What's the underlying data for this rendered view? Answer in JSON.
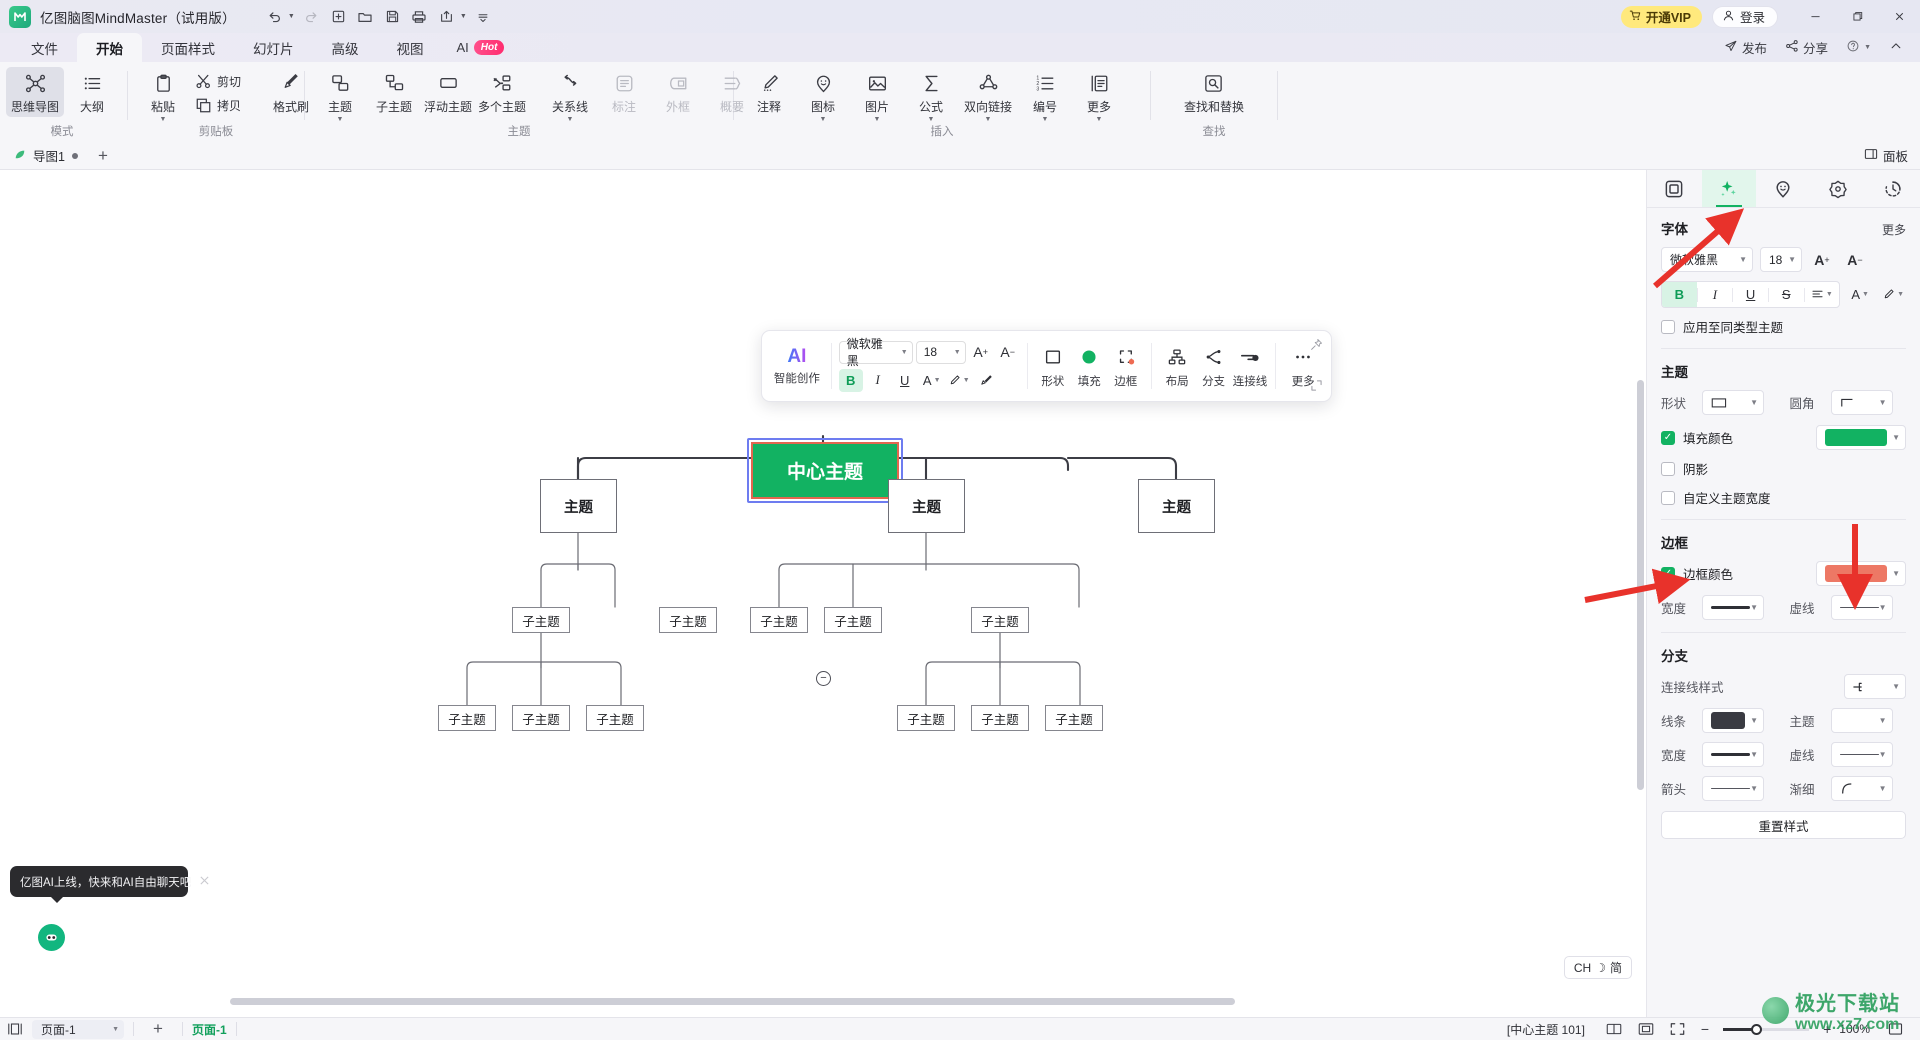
{
  "titlebar": {
    "app_name": "亿图脑图MindMaster（试用版）",
    "logo_glyph": "M",
    "quick_tools": [
      {
        "name": "undo-button",
        "glyph": "↶",
        "caret": true,
        "dim": false
      },
      {
        "name": "redo-button",
        "glyph": "↷",
        "caret": false,
        "dim": true
      },
      {
        "name": "new-button",
        "glyph": "⊞",
        "caret": false,
        "dim": false
      },
      {
        "name": "open-button",
        "glyph": "🗁",
        "caret": false,
        "dim": false
      },
      {
        "name": "save-button",
        "glyph": "🖫",
        "caret": false,
        "dim": false
      },
      {
        "name": "print-button",
        "glyph": "🖨",
        "caret": false,
        "dim": false
      },
      {
        "name": "export-button",
        "glyph": "⇪",
        "caret": true,
        "dim": false
      },
      {
        "name": "customize-toolbar-button",
        "glyph": "▾",
        "caret": false,
        "dim": false
      }
    ],
    "vip_label": "开通VIP",
    "vip_icon": "cart-icon",
    "login_label": "登录",
    "login_icon": "user-icon",
    "window_controls": [
      {
        "name": "minimize-button",
        "glyph": "—"
      },
      {
        "name": "maximize-button",
        "glyph": "❐"
      },
      {
        "name": "close-button",
        "glyph": "✕"
      }
    ]
  },
  "menubar": {
    "tabs": [
      {
        "label": "文件",
        "active": false
      },
      {
        "label": "开始",
        "active": true
      },
      {
        "label": "页面样式",
        "active": false
      },
      {
        "label": "幻灯片",
        "active": false
      },
      {
        "label": "高级",
        "active": false
      },
      {
        "label": "视图",
        "active": false
      }
    ],
    "ai_tab": {
      "label": "AI",
      "badge": "Hot"
    },
    "right_items": [
      {
        "label": "发布",
        "icon": "send-icon",
        "caret": false
      },
      {
        "label": "分享",
        "icon": "share-icon",
        "caret": false
      },
      {
        "label": "",
        "icon": "help-icon",
        "caret": true
      },
      {
        "label": "",
        "icon": "collapse-ribbon-icon",
        "caret": false
      }
    ]
  },
  "ribbon": {
    "groups": [
      {
        "title": "模式",
        "items": [
          {
            "label": "思维导图",
            "icon": "mindmap-icon",
            "selected": true,
            "dropdown": false
          },
          {
            "label": "大纲",
            "icon": "outline-icon",
            "selected": false,
            "dropdown": false
          }
        ]
      },
      {
        "title": "剪贴板",
        "items": [
          {
            "label": "粘贴",
            "icon": "paste-icon",
            "selected": false,
            "dropdown": true
          },
          {
            "label": "剪切",
            "icon": "scissors-icon",
            "selected": false,
            "dropdown": false,
            "horizontal": true
          },
          {
            "label": "拷贝",
            "icon": "copy-icon",
            "selected": false,
            "dropdown": false,
            "horizontal": true
          },
          {
            "label": "格式刷",
            "icon": "format-painter-icon",
            "selected": false,
            "dropdown": false
          }
        ]
      },
      {
        "title": "主题",
        "items": [
          {
            "label": "主题",
            "icon": "topic-icon",
            "selected": false,
            "dropdown": true
          },
          {
            "label": "子主题",
            "icon": "subtopic-icon",
            "selected": false,
            "dropdown": false
          },
          {
            "label": "浮动主题",
            "icon": "floating-topic-icon",
            "selected": false,
            "dropdown": false
          },
          {
            "label": "多个主题",
            "icon": "multi-topic-icon",
            "selected": false,
            "dropdown": false
          },
          {
            "label": "关系线",
            "icon": "relationship-line-icon",
            "selected": false,
            "dropdown": true
          },
          {
            "label": "标注",
            "icon": "callout-icon",
            "selected": false,
            "dropdown": false,
            "disabled": true
          },
          {
            "label": "外框",
            "icon": "boundary-icon",
            "selected": false,
            "dropdown": false,
            "disabled": true
          },
          {
            "label": "概要",
            "icon": "summary-icon",
            "selected": false,
            "dropdown": false,
            "disabled": true
          }
        ]
      },
      {
        "title": "插入",
        "items": [
          {
            "label": "注释",
            "icon": "comment-icon",
            "selected": false,
            "dropdown": false
          },
          {
            "label": "图标",
            "icon": "sticker-icon",
            "selected": false,
            "dropdown": true
          },
          {
            "label": "图片",
            "icon": "image-icon",
            "selected": false,
            "dropdown": true
          },
          {
            "label": "公式",
            "icon": "formula-icon",
            "selected": false,
            "dropdown": true
          },
          {
            "label": "双向链接",
            "icon": "bidirectional-link-icon",
            "selected": false,
            "dropdown": true
          },
          {
            "label": "编号",
            "icon": "numbering-icon",
            "selected": false,
            "dropdown": true
          },
          {
            "label": "更多",
            "icon": "more-insert-icon",
            "selected": false,
            "dropdown": true
          }
        ]
      },
      {
        "title": "查找",
        "items": [
          {
            "label": "查找和替换",
            "icon": "find-replace-icon",
            "selected": false,
            "dropdown": false
          }
        ]
      }
    ]
  },
  "doctabs": {
    "tabs": [
      {
        "label": "导图1",
        "modified": true
      }
    ],
    "add_label": "+",
    "panel_toggle_label": "面板",
    "panel_toggle_icon": "panel-icon"
  },
  "format_toolbar": {
    "ai_title": "AI",
    "ai_subtitle": "智能创作",
    "font_family": "微软雅黑",
    "font_size": "18",
    "increase_font_icon": "A+",
    "decrease_font_icon": "A−",
    "bold": "B",
    "italic": "I",
    "underline": "U",
    "font_color_icon": "A",
    "highlight_icon": "pen-icon",
    "clear_format_icon": "format-painter-icon",
    "big_buttons": [
      {
        "label": "形状",
        "icon": "shape-icon"
      },
      {
        "label": "填充",
        "icon": "fill-icon"
      },
      {
        "label": "边框",
        "icon": "border-icon"
      },
      {
        "label": "布局",
        "icon": "layout-icon"
      },
      {
        "label": "分支",
        "icon": "branch-icon"
      },
      {
        "label": "连接线",
        "icon": "connector-icon"
      },
      {
        "label": "更多",
        "icon": "more-icon"
      }
    ],
    "pin_icon": "pin-icon",
    "resize_icon": "resize-icon",
    "fill_color": "#12b262",
    "border_dot_color": "#ee6b52"
  },
  "mindmap": {
    "central": {
      "text": "中心主题",
      "fill": "#12b262",
      "border": "#e2674f",
      "selection": "#6d7cf0"
    },
    "level1": [
      {
        "text": "主题"
      },
      {
        "text": "主题"
      },
      {
        "text": "主题"
      }
    ],
    "level2": [
      {
        "text": "子主题"
      },
      {
        "text": "子主题"
      },
      {
        "text": "子主题"
      },
      {
        "text": "子主题"
      },
      {
        "text": "子主题"
      }
    ],
    "level3": [
      {
        "text": "子主题"
      },
      {
        "text": "子主题"
      },
      {
        "text": "子主题"
      },
      {
        "text": "子主题"
      },
      {
        "text": "子主题"
      },
      {
        "text": "子主题"
      }
    ],
    "collapse_glyph": "−"
  },
  "toast": {
    "message": "亿图AI上线，快来和AI自由聊天吧",
    "close_icon": "close-icon",
    "bot_icon": "ai-bot-icon"
  },
  "lang_pill": {
    "label": "CH",
    "extra": "简",
    "icon": "ime-icon"
  },
  "right_panel": {
    "tabs": [
      {
        "name": "tab-page",
        "icon": "page-icon",
        "active": false
      },
      {
        "name": "tab-style",
        "icon": "sparkle-icon",
        "active": true
      },
      {
        "name": "tab-sticker",
        "icon": "sticker-icon",
        "active": false
      },
      {
        "name": "tab-theme",
        "icon": "flower-icon",
        "active": false
      },
      {
        "name": "tab-history",
        "icon": "history-icon",
        "active": false
      }
    ],
    "font_section": {
      "title": "字体",
      "more": "更多",
      "family": "微软雅黑",
      "size": "18",
      "increase_icon": "A+",
      "decrease_icon": "A−",
      "bold": "B",
      "italic": "I",
      "underline": "U",
      "strikethrough": "S",
      "align_icon": "align-icon",
      "color_icon": "A",
      "highlight_icon": "pen-icon",
      "apply_same_type": {
        "label": "应用至同类型主题",
        "checked": false
      }
    },
    "topic_section": {
      "title": "主题",
      "shape_label": "形状",
      "shape_icon": "rect-icon",
      "corner_label": "圆角",
      "corner_icon": "corner-icon",
      "fill_color": {
        "label": "填充颜色",
        "checked": true,
        "color": "#12b262"
      },
      "shadow": {
        "label": "阴影",
        "checked": false
      },
      "custom_width": {
        "label": "自定义主题宽度",
        "checked": false
      }
    },
    "border_section": {
      "title": "边框",
      "border_color": {
        "label": "边框颜色",
        "checked": true,
        "color": "#ed7865"
      },
      "width_label": "宽度",
      "dash_label": "虚线"
    },
    "branch_section": {
      "title": "分支",
      "connector_style_label": "连接线样式",
      "connector_style_icon": "branch-style-icon",
      "line_label": "线条",
      "line_color": "#3a3b42",
      "topic_label": "主题",
      "width_label": "宽度",
      "dash_label": "虚线",
      "arrow_label": "箭头",
      "taper_label": "渐细",
      "taper_icon": "taper-icon"
    },
    "reset_button": "重置样式"
  },
  "statusbar": {
    "view_icon": "view-mode-icon",
    "page_select": "页面-1",
    "add_page": "+",
    "page_label": "页面-1",
    "selection_info": "[中心主题 101]",
    "right_icons": [
      {
        "name": "two-page-view-icon",
        "glyph": "▥"
      },
      {
        "name": "fit-page-icon",
        "glyph": "▣"
      },
      {
        "name": "fullscreen-icon",
        "glyph": "⛶"
      }
    ],
    "zoom_out": "−",
    "zoom_in": "+",
    "zoom_level": "100%",
    "fullscreen_icon": "expand-icon"
  },
  "watermark": {
    "main": "极光下载站",
    "sub": "www.xz7.com"
  }
}
